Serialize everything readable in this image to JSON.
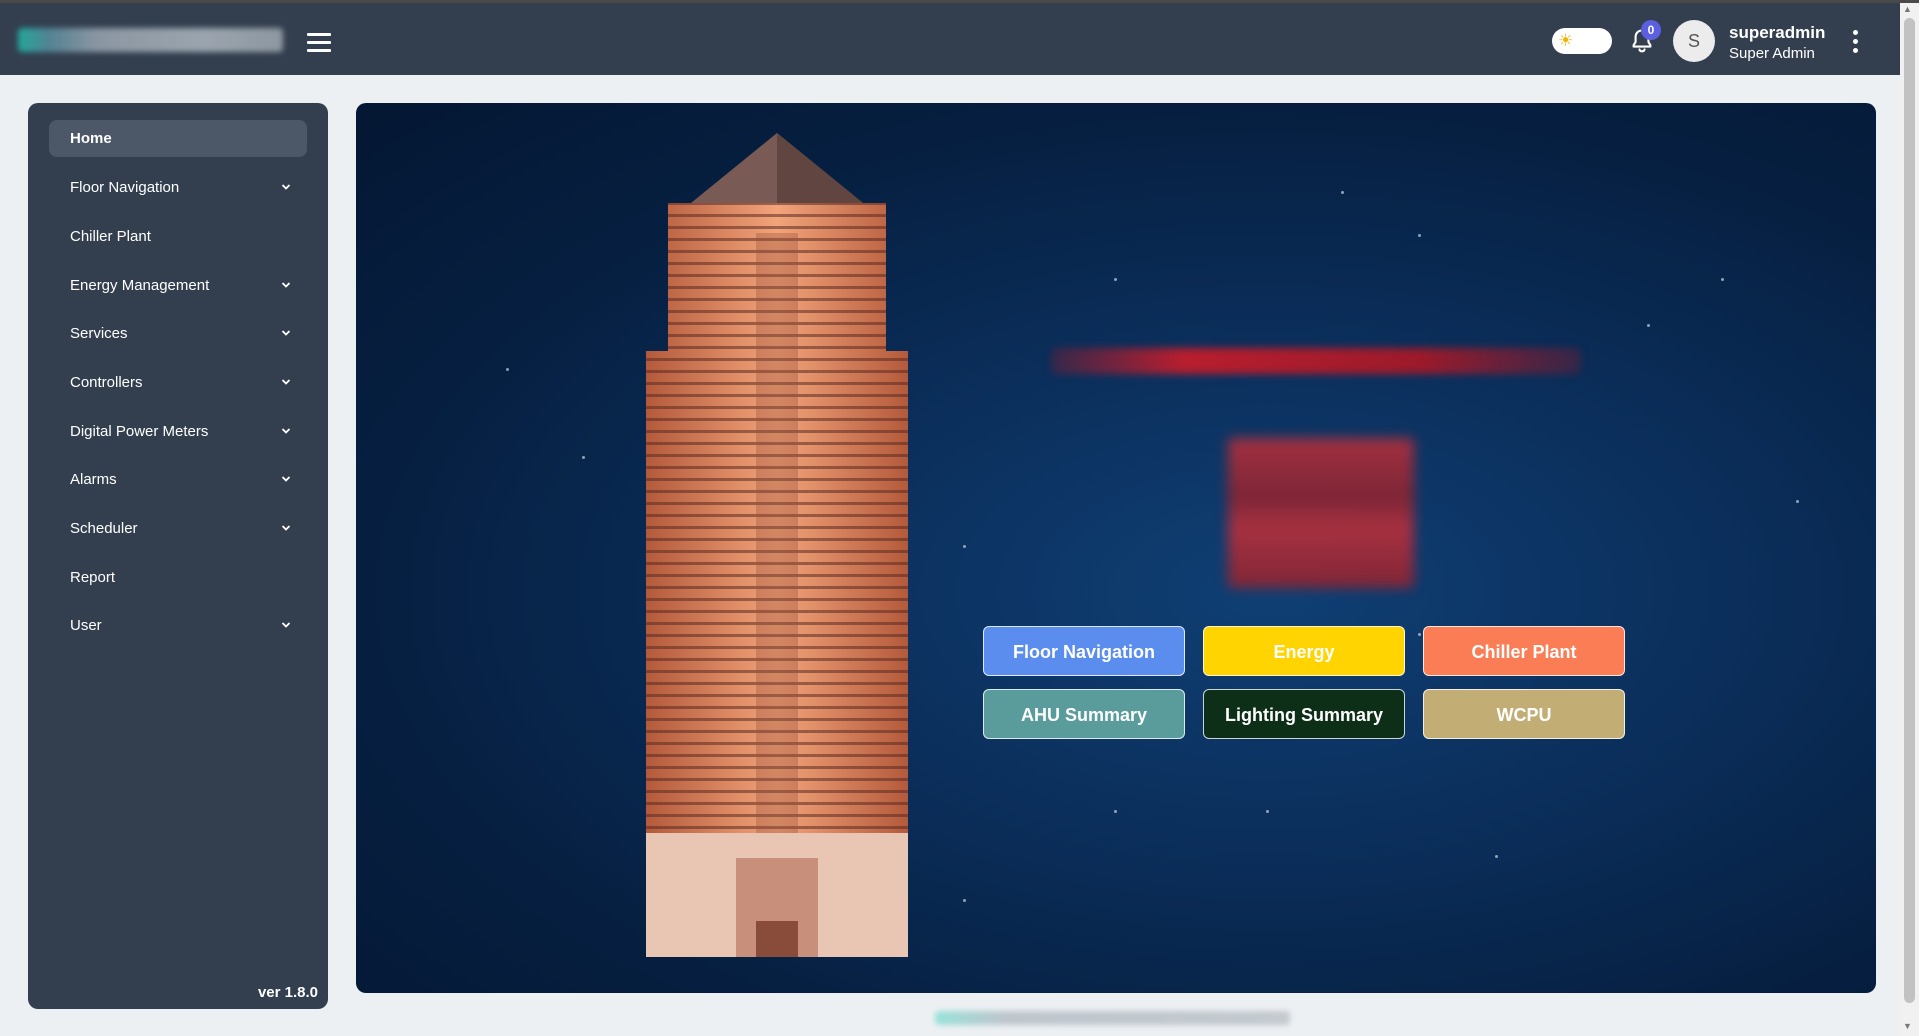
{
  "header": {
    "user": {
      "initial": "S",
      "name": "superadmin",
      "role": "Super Admin"
    },
    "notifications": {
      "count": "0"
    },
    "theme_toggle": {
      "mode": "light",
      "icon": "sun-icon"
    }
  },
  "sidebar": {
    "items": [
      {
        "label": "Home",
        "active": true,
        "expandable": false
      },
      {
        "label": "Floor Navigation",
        "expandable": true
      },
      {
        "label": "Chiller Plant",
        "expandable": false
      },
      {
        "label": "Energy Management",
        "expandable": true
      },
      {
        "label": "Services",
        "expandable": true
      },
      {
        "label": "Controllers",
        "expandable": true
      },
      {
        "label": "Digital Power Meters",
        "expandable": true
      },
      {
        "label": "Alarms",
        "expandable": true
      },
      {
        "label": "Scheduler",
        "expandable": true
      },
      {
        "label": "Report",
        "expandable": false
      },
      {
        "label": "User",
        "expandable": true
      }
    ],
    "version": "ver 1.8.0"
  },
  "quick_links": [
    {
      "label": "Floor Navigation",
      "color": "#5b8def"
    },
    {
      "label": "Energy",
      "color": "#ffd400"
    },
    {
      "label": "Chiller Plant",
      "color": "#fb7d55"
    },
    {
      "label": "AHU Summary",
      "color": "#5a9c9c"
    },
    {
      "label": "Lighting Summary",
      "color": "#0d2f18"
    },
    {
      "label": "WCPU",
      "color": "#c2ae75"
    }
  ],
  "colors": {
    "topbar": "#333f4f",
    "sidebar": "#333f4f",
    "page_bg": "#edf0f3",
    "hero_bg": "#0b2f5c"
  }
}
